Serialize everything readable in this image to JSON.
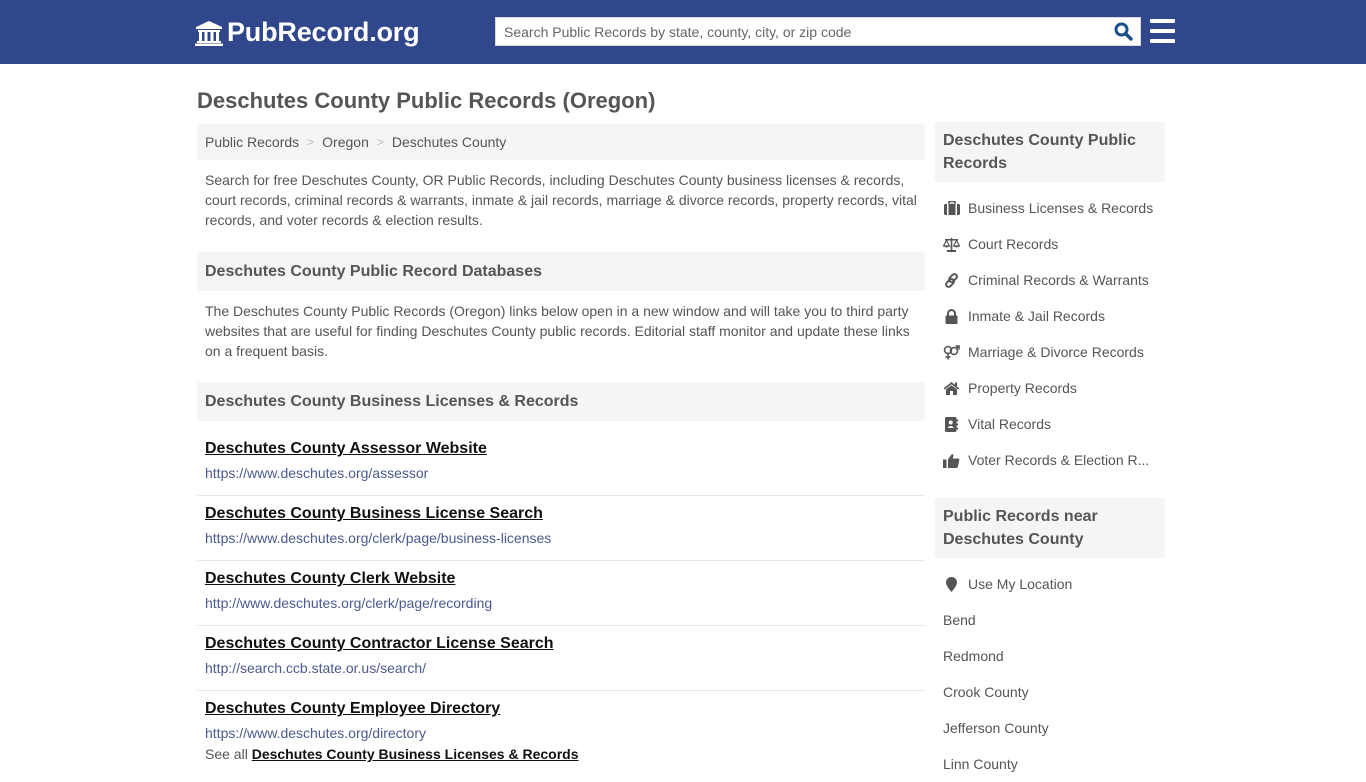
{
  "header": {
    "logo_text": "PubRecord.org",
    "search_placeholder": "Search Public Records by state, county, city, or zip code",
    "colors": {
      "bar": "#31478b",
      "search_icon": "#1a4f8c"
    }
  },
  "page": {
    "title": "Deschutes County Public Records (Oregon)",
    "breadcrumb": [
      "Public Records",
      "Oregon",
      "Deschutes County"
    ],
    "intro": "Search for free Deschutes County, OR Public Records, including Deschutes County business licenses & records, court records, criminal records & warrants, inmate & jail records, marriage & divorce records, property records, vital records, and voter records & election results."
  },
  "databases": {
    "heading": "Deschutes County Public Record Databases",
    "description": "The Deschutes County Public Records (Oregon) links below open in a new window and will take you to third party websites that are useful for finding Deschutes County public records. Editorial staff monitor and update these links on a frequent basis."
  },
  "business": {
    "heading": "Deschutes County Business Licenses & Records",
    "links": [
      {
        "title": "Deschutes County Assessor Website",
        "url": "https://www.deschutes.org/assessor"
      },
      {
        "title": "Deschutes County Business License Search",
        "url": "https://www.deschutes.org/clerk/page/business-licenses"
      },
      {
        "title": "Deschutes County Clerk Website",
        "url": "http://www.deschutes.org/clerk/page/recording"
      },
      {
        "title": "Deschutes County Contractor License Search",
        "url": "http://search.ccb.state.or.us/search/"
      },
      {
        "title": "Deschutes County Employee Directory",
        "url": "https://www.deschutes.org/directory"
      }
    ],
    "see_all_prefix": "See all",
    "see_all_link": "Deschutes County Business Licenses & Records"
  },
  "sidebar": {
    "categories_heading": "Deschutes County Public Records",
    "categories": [
      {
        "label": "Business Licenses & Records",
        "icon": "briefcase-icon"
      },
      {
        "label": "Court Records",
        "icon": "scale-icon"
      },
      {
        "label": "Criminal Records & Warrants",
        "icon": "link-icon"
      },
      {
        "label": "Inmate & Jail Records",
        "icon": "lock-icon"
      },
      {
        "label": "Marriage & Divorce Records",
        "icon": "gender-icon"
      },
      {
        "label": "Property Records",
        "icon": "home-icon"
      },
      {
        "label": "Vital Records",
        "icon": "contact-book-icon"
      },
      {
        "label": "Voter Records & Election R...",
        "icon": "thumbs-up-icon"
      }
    ],
    "nearby_heading": "Public Records near Deschutes County",
    "use_location": "Use My Location",
    "nearby": [
      "Bend",
      "Redmond",
      "Crook County",
      "Jefferson County",
      "Linn County"
    ]
  }
}
